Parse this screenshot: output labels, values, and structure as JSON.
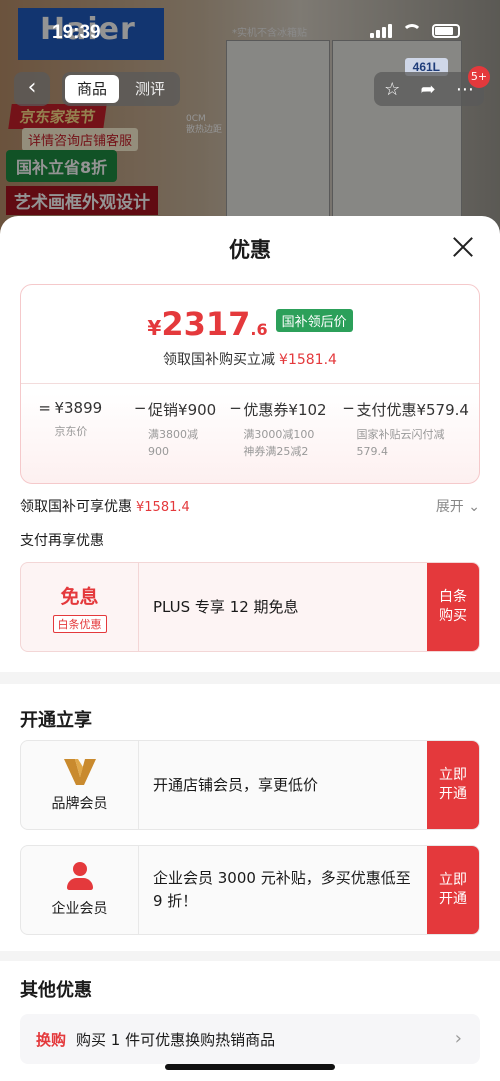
{
  "background": {
    "brand": "Haier",
    "time": "19:39",
    "note": "*实机不含冰箱贴",
    "capacity": "461L",
    "dimension_label": "0CM\n散热边距",
    "cart_count": "5+",
    "tabs": [
      "商品",
      "测评"
    ],
    "promos": [
      "京东家装节",
      "详情咨询店铺客服",
      "国补立省8折",
      "艺术画框外观设计"
    ]
  },
  "sheet": {
    "title": "优惠",
    "price": {
      "currency": "¥",
      "integer": "2317",
      "decimal": ".6",
      "tag": "国补领后价",
      "subtitle": "领取国补购买立减",
      "subtitle_amount": "¥1581.4"
    },
    "formula": {
      "ops": [
        "=",
        "−",
        "−",
        "−"
      ],
      "items": [
        {
          "value": "¥3899",
          "desc": "京东价"
        },
        {
          "value": "促销¥900",
          "desc": "满3800减900"
        },
        {
          "value": "优惠券¥102",
          "desc": "满3000减100\n神券满25减2"
        },
        {
          "value": "支付优惠¥579.4",
          "desc": "国家补贴云闪付减579.4"
        }
      ]
    },
    "guobu_row": {
      "label": "领取国补可享优惠",
      "amount": "¥1581.4",
      "expand": "展开"
    },
    "pay_title": "支付再享优惠",
    "baitiao": {
      "title": "免息",
      "tag": "白条优惠",
      "text": "PLUS 专享 12 期免息",
      "button": "白条\n购买"
    },
    "kaitong_title": "开通立享",
    "brand_member": {
      "label": "品牌会员",
      "text": "开通店铺会员，享更低价",
      "button": "立即\n开通"
    },
    "enterprise_member": {
      "label": "企业会员",
      "text": "企业会员 3000 元补贴，多买优惠低至 9 折！",
      "button": "立即\n开通"
    },
    "other_title": "其他优惠",
    "swap": {
      "tag": "换购",
      "text": "购买 1 件可优惠换购热销商品"
    }
  },
  "colors": {
    "accent": "#e4393c",
    "green_tag": "#2ca05a",
    "brand_gold": "#c98a2e"
  },
  "icons": [
    "back-icon",
    "star-icon",
    "share-icon",
    "more-icon",
    "close-icon",
    "chevron-down-icon",
    "chevron-right-icon",
    "brand-v-icon",
    "person-icon"
  ]
}
